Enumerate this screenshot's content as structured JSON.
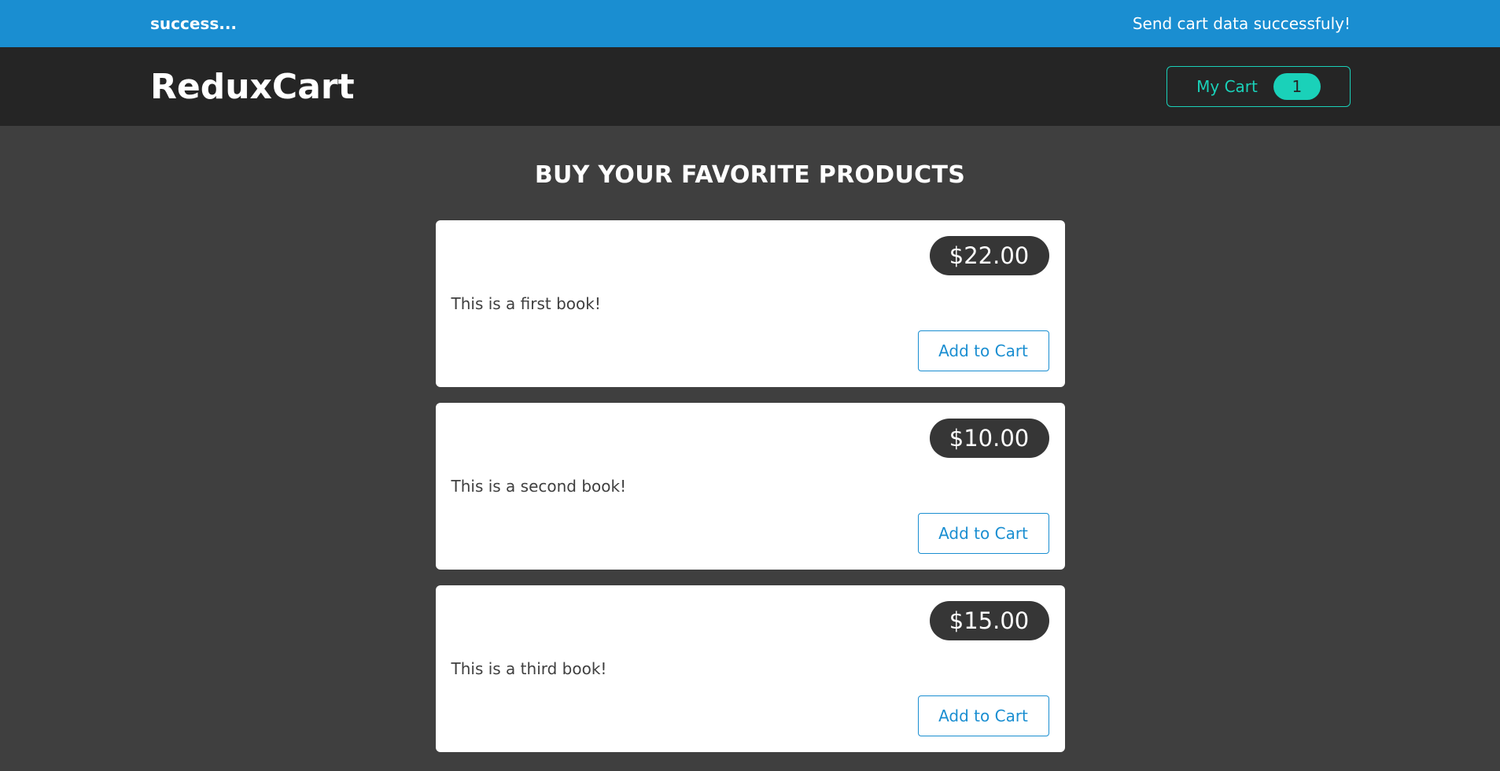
{
  "notification": {
    "status": "success...",
    "message": "Send cart data successfuly!"
  },
  "header": {
    "brand": "ReduxCart",
    "cart_label": "My Cart",
    "cart_count": "1"
  },
  "main": {
    "title": "BUY YOUR FAVORITE PRODUCTS",
    "products": [
      {
        "price": "$22.00",
        "description": "This is a first book!",
        "button_label": "Add to Cart"
      },
      {
        "price": "$10.00",
        "description": "This is a second book!",
        "button_label": "Add to Cart"
      },
      {
        "price": "$15.00",
        "description": "This is a third book!",
        "button_label": "Add to Cart"
      }
    ]
  },
  "colors": {
    "notification_bg": "#1a8ed1",
    "header_bg": "#252525",
    "page_bg": "#3f3f3f",
    "accent_teal": "#1ad1b9",
    "price_bg": "#363636"
  }
}
